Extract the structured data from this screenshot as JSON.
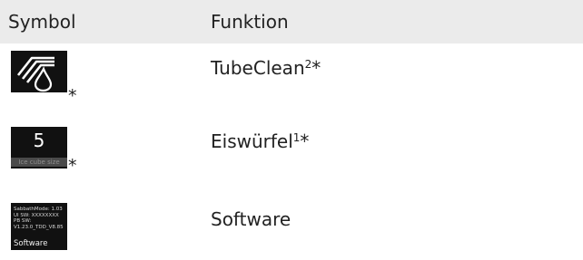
{
  "table": {
    "headers": {
      "symbol": "Symbol",
      "function": "Funktion"
    },
    "rows": [
      {
        "icon": "tubeclean-drop-icon",
        "name": "TubeClean",
        "footnote": "2",
        "suffix": "*",
        "icon_marker": "*"
      },
      {
        "icon": "ice-cube-display-icon",
        "name": "Eiswürfel",
        "footnote": "1",
        "suffix": "*",
        "icon_marker": "*",
        "display_value": "5",
        "display_caption": "Ice cube size"
      },
      {
        "icon": "software-info-screen-icon",
        "name": "Software",
        "footnote": "",
        "suffix": "",
        "icon_marker": "",
        "screen_lines": [
          "SabbathMode: 1.03",
          "UI SW: XXXXXXXX",
          "PB SW:",
          "V1.23.0_TDD_V8.85"
        ],
        "screen_title": "Software"
      }
    ]
  }
}
